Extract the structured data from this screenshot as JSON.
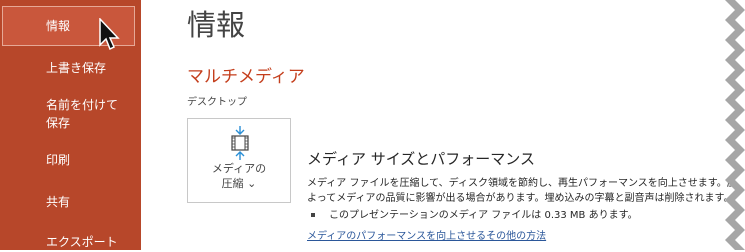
{
  "sidebar": {
    "items": [
      {
        "label": "情報",
        "selected": true
      },
      {
        "label": "上書き保存"
      },
      {
        "label": "名前を付けて保存"
      },
      {
        "label": "印刷"
      },
      {
        "label": "共有"
      },
      {
        "label": "エクスポート"
      }
    ]
  },
  "main": {
    "title": "情報",
    "section_title": "マルチメディア",
    "location": "デスクトップ",
    "compress_button": {
      "line1": "メディアの",
      "line2": "圧縮 ⌄"
    },
    "media": {
      "heading": "メディア サイズとパフォーマンス",
      "desc_line1": "メディア ファイルを圧縮して、ディスク領域を節約し、再生パフォーマンスを向上させます。圧縮に",
      "desc_line2": "よってメディアの品質に影響が出る場合があります。埋め込みの字幕と副音声は削除されます。",
      "bullet": "このプレゼンテーションのメディア ファイルは 0.33 MB あります。",
      "link": "メディアのパフォーマンスを向上させるその他の方法"
    }
  },
  "colors": {
    "sidebar": "#b7472a",
    "accent": "#c43e1c",
    "link": "#2b579a"
  },
  "icons": [
    "mouse-pointer-icon",
    "compress-media-icon"
  ]
}
